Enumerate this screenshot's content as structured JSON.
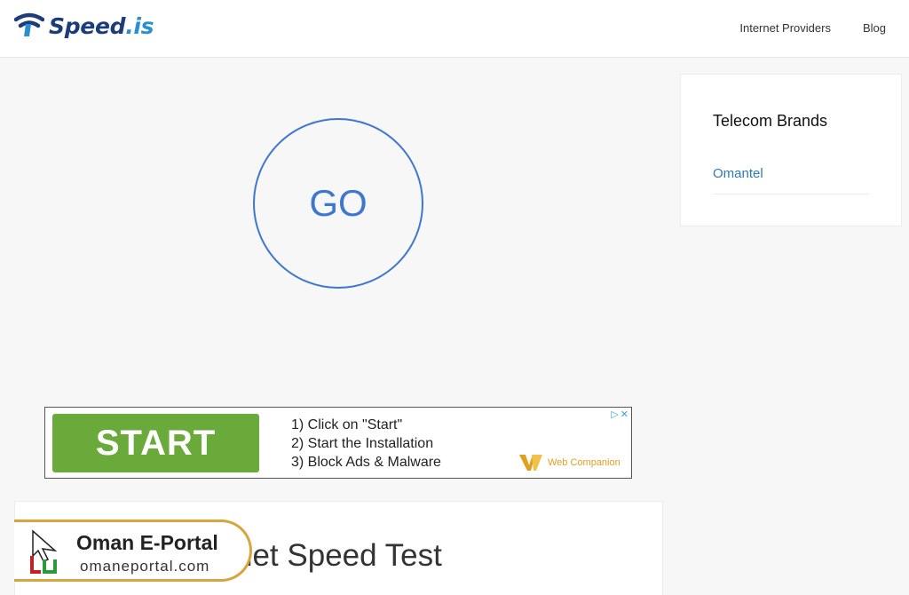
{
  "header": {
    "logo_main": "Speed",
    "logo_tld": ".is",
    "nav": [
      "Internet Providers",
      "Blog"
    ]
  },
  "speedtest": {
    "go_label": "GO",
    "accent_color": "#3d77cf"
  },
  "sidebar": {
    "title": "Telecom Brands",
    "brands": [
      "Omantel"
    ]
  },
  "ad": {
    "start_label": "START",
    "steps": [
      "1) Click on \"Start\"",
      "2) Start the Installation",
      "3) Block Ads & Malware"
    ],
    "brand": "Web Companion",
    "start_color": "#6aaa3a"
  },
  "content": {
    "heading_visible": "net Speed Test"
  },
  "watermark": {
    "title": "Oman E-Portal",
    "url": "omaneportal.com"
  }
}
